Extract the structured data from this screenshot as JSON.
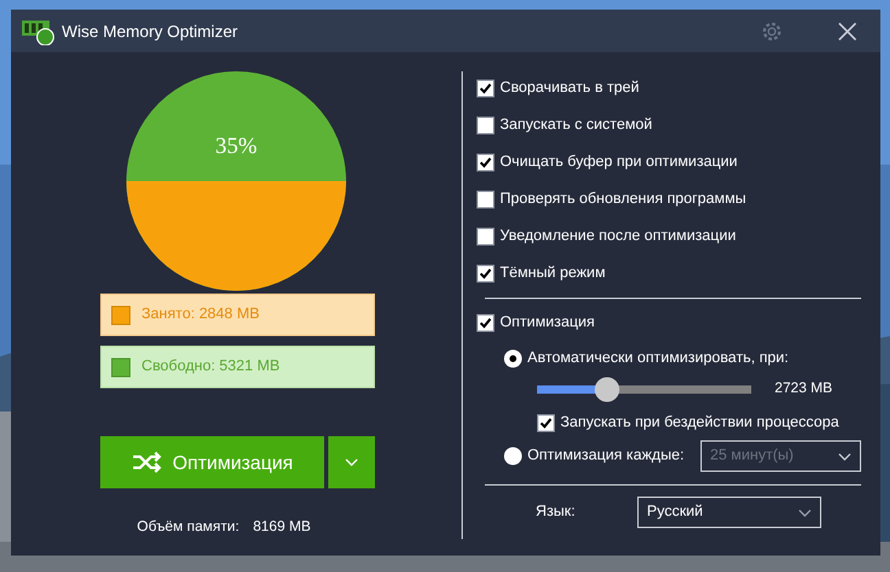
{
  "window": {
    "title": "Wise Memory Optimizer"
  },
  "memory": {
    "usage_label": "35%",
    "legend": [
      {
        "kind": "used",
        "text": "Занято: 2848 MB",
        "color": "#f7a20c"
      },
      {
        "kind": "free",
        "text": "Свободно: 5321 MB",
        "color": "#5db336"
      }
    ],
    "optimize_button": "Оптимизация",
    "total_label": "Объём памяти:",
    "total_value": "8169 MB"
  },
  "options": [
    {
      "label": "Сворачивать в трей",
      "checked": true
    },
    {
      "label": "Запускать с системой",
      "checked": false
    },
    {
      "label": "Очищать буфер при оптимизации",
      "checked": true
    },
    {
      "label": "Проверять обновления программы",
      "checked": false
    },
    {
      "label": "Уведомление после оптимизации",
      "checked": false
    },
    {
      "label": "Тёмный режим",
      "checked": true
    }
  ],
  "optimization": {
    "label": "Оптимизация",
    "checked": true,
    "modes": [
      {
        "kind": "threshold",
        "label": "Автоматически оптимизировать, при:",
        "selected": true
      },
      {
        "kind": "interval",
        "label": "Оптимизация каждые:",
        "selected": false
      }
    ],
    "slider": {
      "level": 0.33,
      "reading": "2723 MB"
    },
    "idle": {
      "label": "Запускать при бездействии процессора",
      "checked": true
    },
    "interval": {
      "value": "25 минут(ы)",
      "disabled": true
    }
  },
  "language": {
    "label": "Язык:",
    "value": "Русский"
  }
}
